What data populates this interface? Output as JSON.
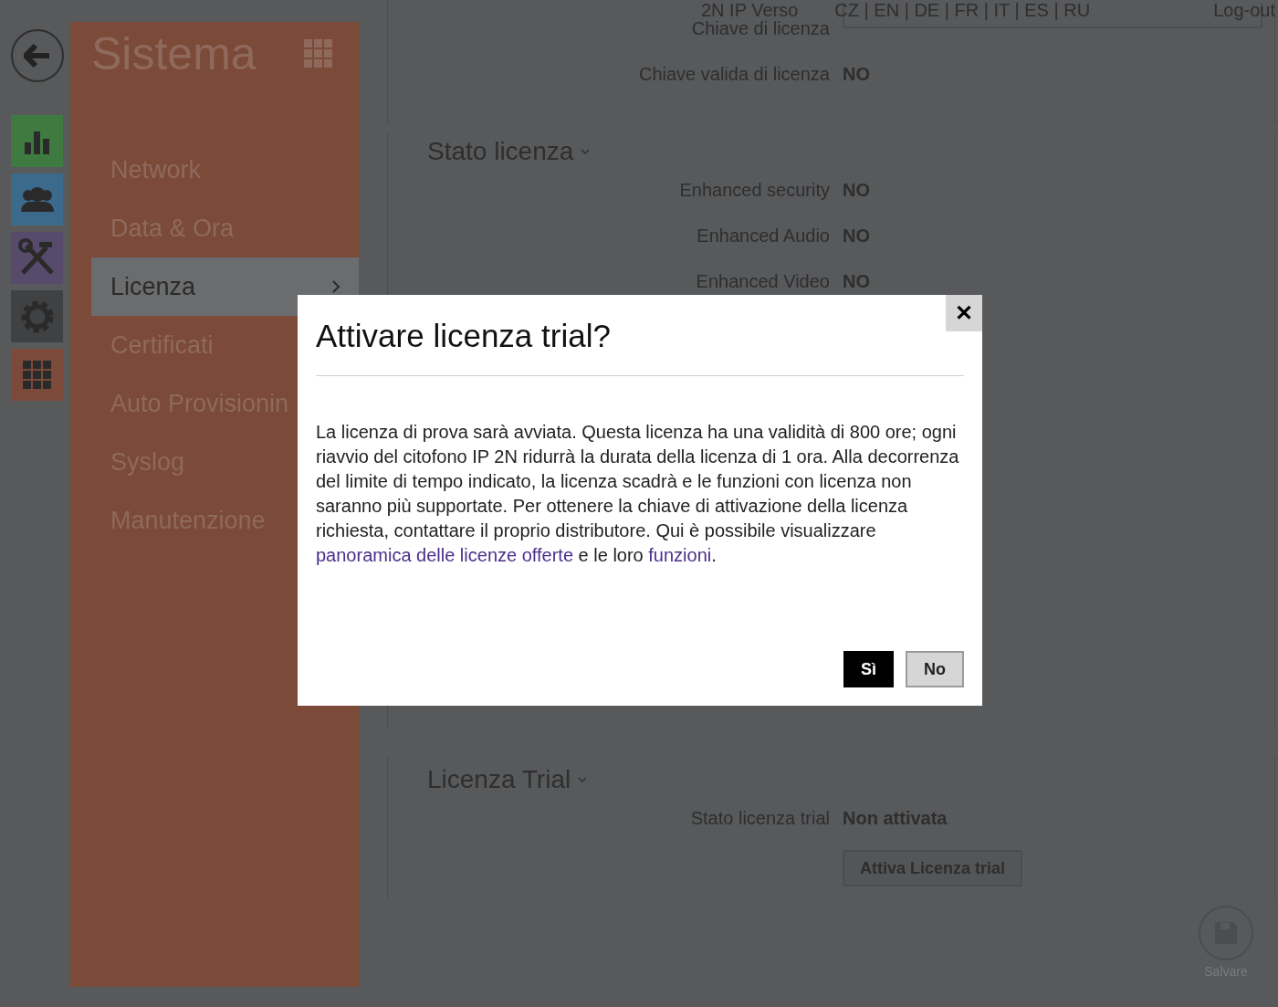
{
  "header": {
    "device": "2N IP Verso",
    "languages": "CZ | EN | DE | FR | IT | ES | RU",
    "logout": "Log-out"
  },
  "rail": [
    {
      "kind": "chart",
      "color": "#3f7a40"
    },
    {
      "kind": "users",
      "color": "#3b6a8d"
    },
    {
      "kind": "tools",
      "color": "#574a6b"
    },
    {
      "kind": "gear",
      "color": "#404143"
    },
    {
      "kind": "grid",
      "color": "#7b4a39"
    }
  ],
  "sidebar": {
    "title": "Sistema",
    "items": [
      {
        "label": "Network",
        "selected": false
      },
      {
        "label": "Data & Ora",
        "selected": false
      },
      {
        "label": "Licenza",
        "selected": true
      },
      {
        "label": "Certificati",
        "selected": false
      },
      {
        "label": "Auto Provisionin",
        "selected": false
      },
      {
        "label": "Syslog",
        "selected": false
      },
      {
        "label": "Manutenzione",
        "selected": false
      }
    ]
  },
  "sections": [
    {
      "rows": [
        {
          "label": "Chiave di licenza",
          "kind": "field"
        },
        {
          "label": "Chiave valida di licenza",
          "kind": "value",
          "value": "NO"
        }
      ]
    },
    {
      "title": "Stato licenza",
      "rows": [
        {
          "label": "Enhanced security",
          "kind": "value",
          "value": "NO"
        },
        {
          "label": "Enhanced Audio",
          "kind": "value",
          "value": "NO"
        },
        {
          "label": "Enhanced Video",
          "kind": "value",
          "value": "NO"
        }
      ]
    },
    {
      "title": "Licenza Trial",
      "rows": [
        {
          "label": "Stato licenza trial",
          "kind": "value",
          "value": "Non attivata"
        },
        {
          "kind": "button",
          "label": "Attiva Licenza trial"
        }
      ]
    }
  ],
  "save": {
    "label": "Salvare"
  },
  "dialog": {
    "title": "Attivare licenza trial?",
    "close": "✕",
    "body": [
      {
        "kind": "text",
        "text": "La licenza di prova sarà avviata. Questa licenza ha una validità di 800 ore; ogni riavvio del citofono IP 2N ridurrà la durata della licenza di 1 ora. Alla decorrenza del limite di tempo indicato, la licenza scadrà e le funzioni con licenza non saranno più supportate. Per ottenere la chiave di attivazione della licenza richiesta, contattare il proprio distributore. Qui è possibile visualizzare "
      },
      {
        "kind": "link",
        "text": "panoramica delle licenze offerte"
      },
      {
        "kind": "text",
        "text": " e le loro "
      },
      {
        "kind": "link",
        "text": "funzioni"
      },
      {
        "kind": "text",
        "text": "."
      }
    ],
    "buttons": [
      {
        "label": "Sì",
        "primary": true
      },
      {
        "label": "No",
        "primary": false
      }
    ]
  }
}
